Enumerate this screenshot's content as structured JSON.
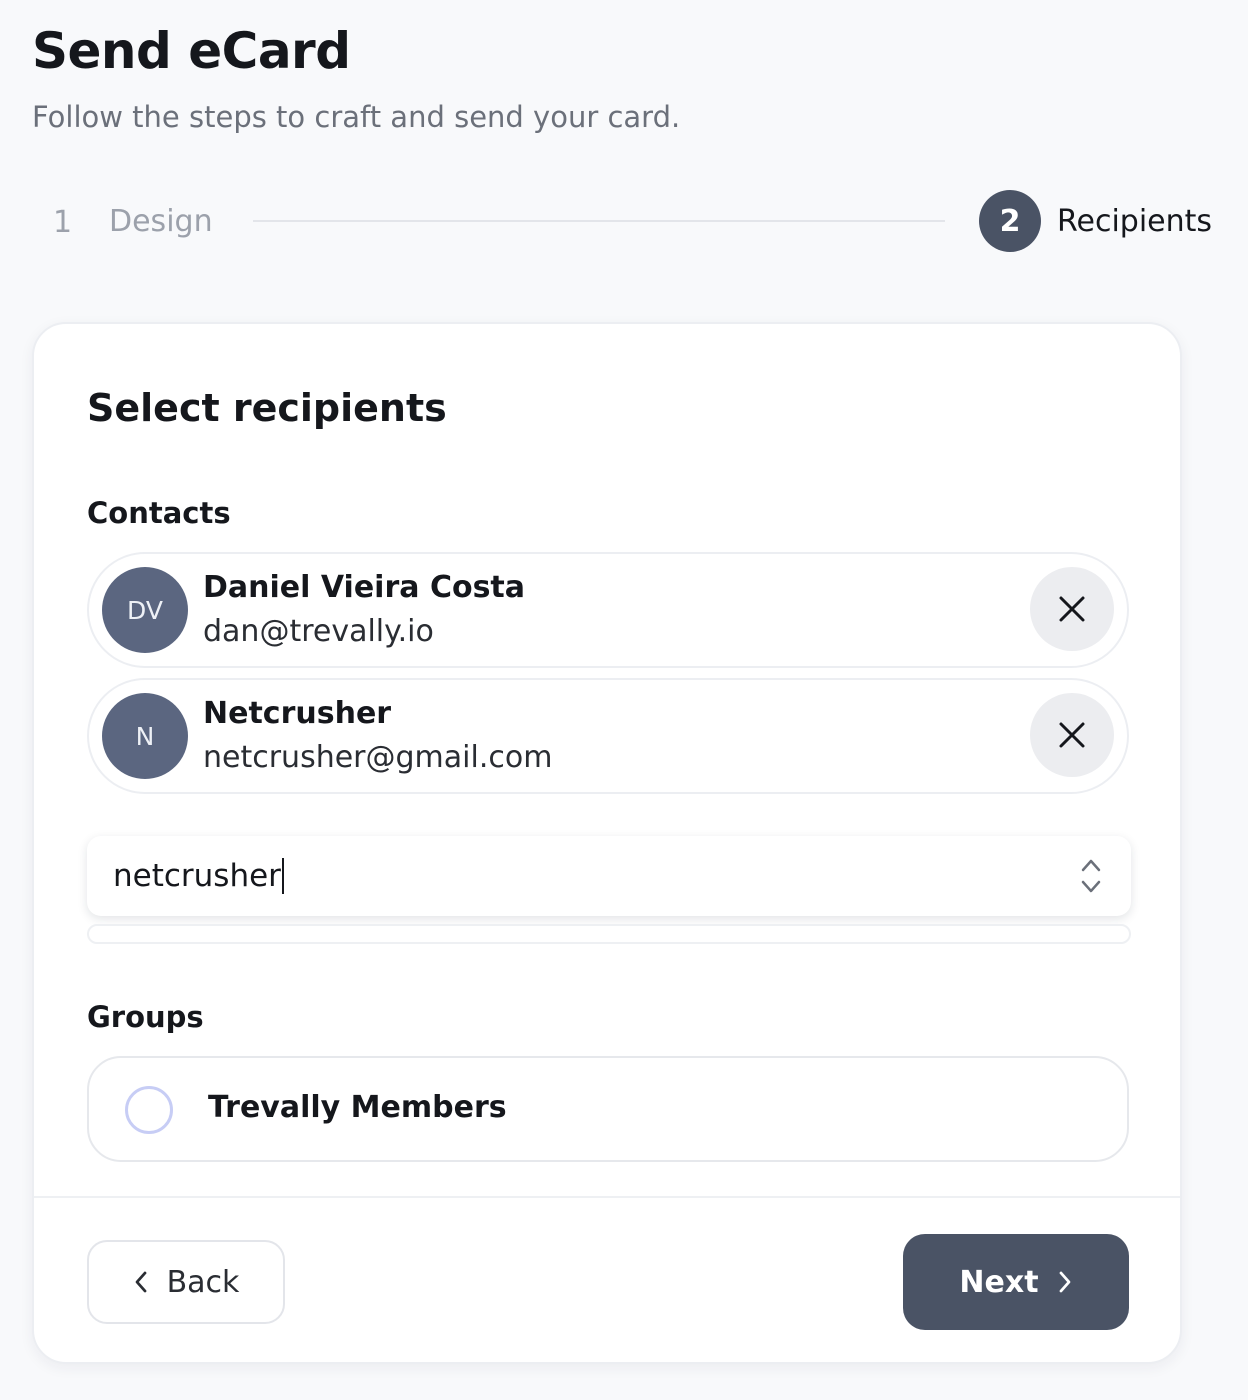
{
  "header": {
    "title": "Send eCard",
    "subtitle": "Follow the steps to craft and send your card."
  },
  "stepper": {
    "steps": [
      {
        "number": "1",
        "label": "Design",
        "state": "inactive"
      },
      {
        "number": "2",
        "label": "Recipients",
        "state": "active"
      }
    ]
  },
  "card": {
    "title": "Select recipients",
    "contacts": {
      "label": "Contacts",
      "items": [
        {
          "initials": "DV",
          "name": "Daniel Vieira Costa",
          "email": "dan@trevally.io"
        },
        {
          "initials": "N",
          "name": "Netcrusher",
          "email": "netcrusher@gmail.com"
        }
      ],
      "search_value": "netcrusher"
    },
    "groups": {
      "label": "Groups",
      "items": [
        {
          "name": "Trevally Members",
          "selected": false
        }
      ]
    }
  },
  "footer": {
    "back_label": "Back",
    "next_label": "Next"
  },
  "icons": {
    "remove": "close-icon",
    "select": "chevron-up-down-icon",
    "back": "chevron-left-icon",
    "next": "chevron-right-icon"
  },
  "colors": {
    "accent": "#4a5365",
    "avatar": "#5b6680",
    "radio_ring": "#c7cdf5"
  }
}
